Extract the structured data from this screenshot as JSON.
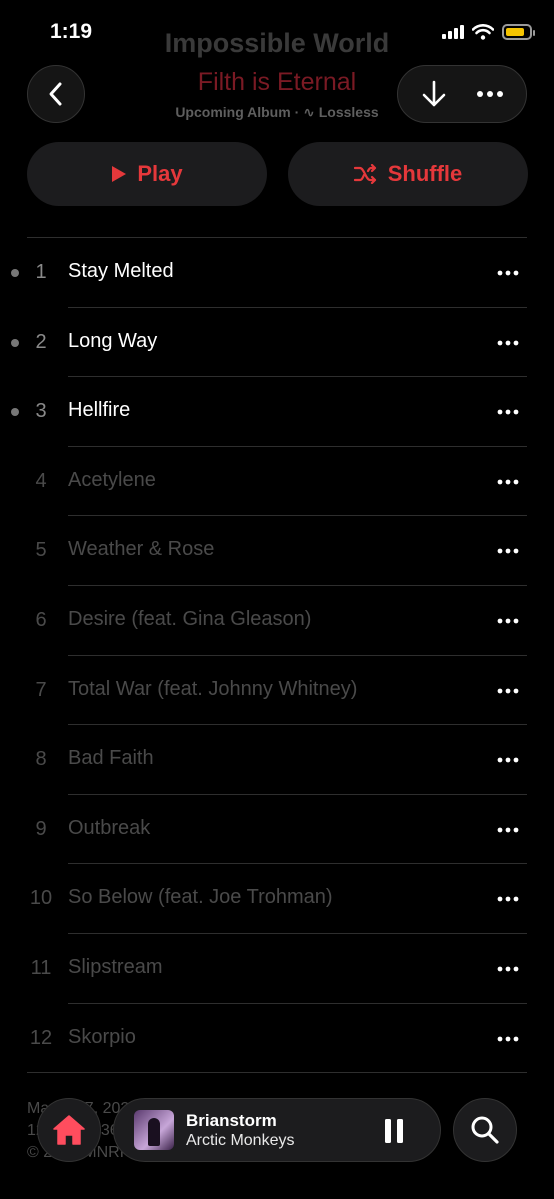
{
  "status_bar": {
    "time": "1:19",
    "battery_color": "#f5c400"
  },
  "album": {
    "title": "Impossible World",
    "artist": "Filth is Eternal",
    "meta": "Upcoming Album · ∿ Lossless"
  },
  "actions": {
    "play_label": "Play",
    "shuffle_label": "Shuffle"
  },
  "tracks": [
    {
      "number": "1",
      "title": "Stay Melted",
      "available": true
    },
    {
      "number": "2",
      "title": "Long Way",
      "available": true
    },
    {
      "number": "3",
      "title": "Hellfire",
      "available": true
    },
    {
      "number": "4",
      "title": "Acetylene",
      "available": false
    },
    {
      "number": "5",
      "title": "Weather & Rose",
      "available": false
    },
    {
      "number": "6",
      "title": "Desire (feat. Gina Gleason)",
      "available": false
    },
    {
      "number": "7",
      "title": "Total War (feat. Johnny Whitney)",
      "available": false
    },
    {
      "number": "8",
      "title": "Bad Faith",
      "available": false
    },
    {
      "number": "9",
      "title": "Outbreak",
      "available": false
    },
    {
      "number": "10",
      "title": "So Below (feat. Joe Trohman)",
      "available": false
    },
    {
      "number": "11",
      "title": "Slipstream",
      "available": false
    },
    {
      "number": "12",
      "title": "Skorpio",
      "available": false
    }
  ],
  "footer": {
    "release_date": "March 17, 2023",
    "summary": "12 songs, 36 minutes",
    "copyright": "© 2023 MNRK Records LP"
  },
  "now_playing": {
    "title": "Brianstorm",
    "artist": "Arctic Monkeys"
  },
  "colors": {
    "accent": "#e5383b",
    "artist": "#7a1a24",
    "background": "#000000"
  },
  "icons": [
    "back-chevron-icon",
    "download-icon",
    "more-icon",
    "play-icon",
    "shuffle-icon",
    "home-icon",
    "pause-icon",
    "search-icon"
  ]
}
